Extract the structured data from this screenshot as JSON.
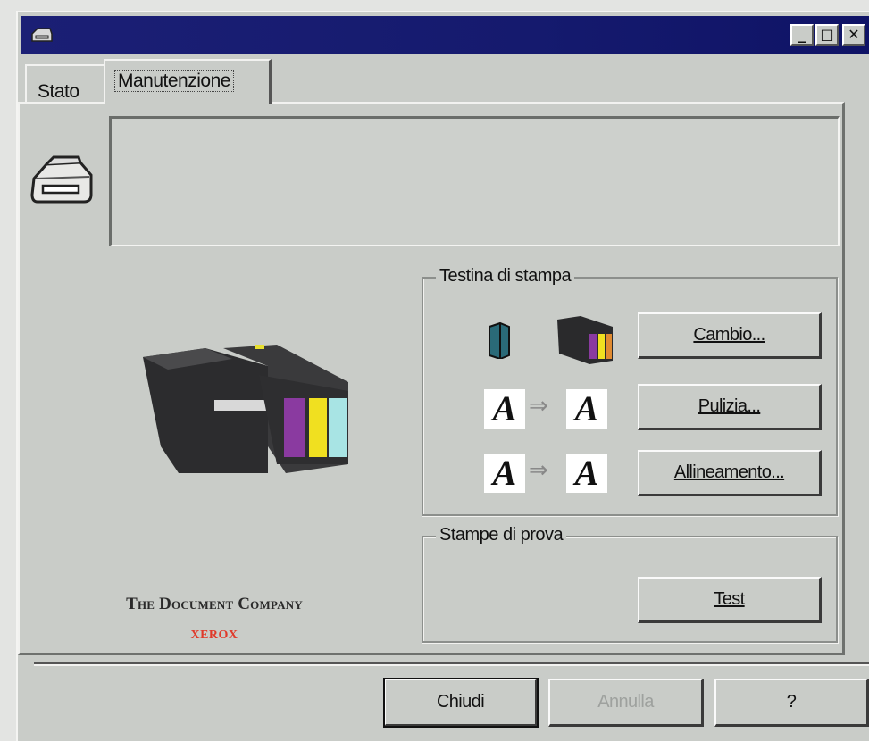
{
  "window": {
    "controls": {
      "minimize": "_",
      "maximize": "□",
      "close": "✕"
    }
  },
  "tabs": [
    {
      "label": "Stato",
      "selected": false
    },
    {
      "label": "Manutenzione",
      "selected": true
    }
  ],
  "status_box": {
    "text": ""
  },
  "print_head": {
    "group_label": "Testina di stampa",
    "change_label": "Cambio...",
    "clean_label": "Pulizia...",
    "align_label": "Allineamento...",
    "glyph_before": "A",
    "glyph_after": "A",
    "arrow": "⇒"
  },
  "test_prints": {
    "group_label": "Stampe di prova",
    "test_label": "Test"
  },
  "brand": {
    "company": "The Document Company",
    "name": "XEROX"
  },
  "footer": {
    "close_label": "Chiudi",
    "cancel_label": "Annulla",
    "help_label": "?"
  },
  "colors": {
    "titlebar": "#1b1f75",
    "face": "#c9ccc8",
    "brand_red": "#e0392a",
    "ink_magenta": "#8a3aa0",
    "ink_yellow": "#f0e020",
    "ink_cyan": "#a8e4e4"
  },
  "icons": [
    "printer-icon",
    "ink-cartridge-icon",
    "color-cartridge-icon",
    "print-head-illustration"
  ]
}
